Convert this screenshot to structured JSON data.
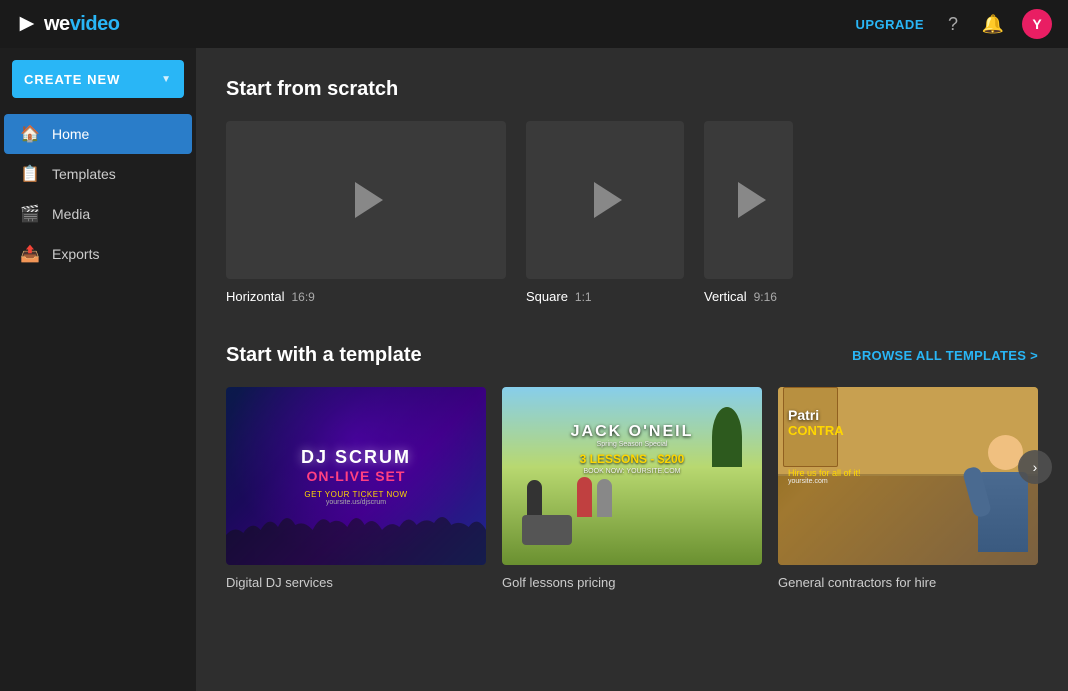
{
  "topnav": {
    "logo_text": "wevideo",
    "upgrade_label": "UPGRADE",
    "avatar_letter": "Y"
  },
  "sidebar": {
    "create_new_label": "CREATE NEW",
    "items": [
      {
        "id": "home",
        "label": "Home",
        "icon": "🏠",
        "active": true
      },
      {
        "id": "templates",
        "label": "Templates",
        "icon": "📋",
        "active": false
      },
      {
        "id": "media",
        "label": "Media",
        "icon": "🎬",
        "active": false
      },
      {
        "id": "exports",
        "label": "Exports",
        "icon": "📤",
        "active": false
      }
    ]
  },
  "content": {
    "scratch_section_title": "Start from scratch",
    "scratch_items": [
      {
        "id": "horizontal",
        "label": "Horizontal",
        "ratio": "16:9"
      },
      {
        "id": "square",
        "label": "Square",
        "ratio": "1:1"
      },
      {
        "id": "vertical",
        "label": "Vertical",
        "ratio": "9:16"
      }
    ],
    "template_section_title": "Start with a template",
    "browse_all_label": "BROWSE ALL TEMPLATES >",
    "templates": [
      {
        "id": "dj",
        "label": "Digital DJ services",
        "name": "DJ SCRUM",
        "subtitle": "ON-LIVE SET",
        "cta": "GET YOUR TICKET NOW",
        "site": "yoursite.us/djscrum"
      },
      {
        "id": "golf",
        "label": "Golf lessons pricing",
        "brand": "JACK O'NEIL",
        "tagline": "Spring Season Special",
        "lessons": "3 LESSONS - $200",
        "book": "BOOK NOW: YOURSITE.COM"
      },
      {
        "id": "contractor",
        "label": "General contractors for hire",
        "name": "Patri",
        "subtitle": "CONTRA",
        "cta": "Hire us for all of it!",
        "site": "yoursite.com"
      }
    ]
  }
}
